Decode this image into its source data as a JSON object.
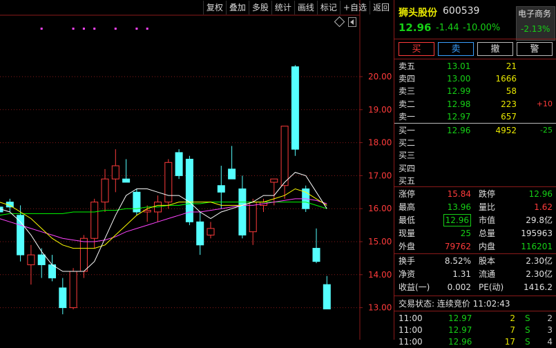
{
  "toolbar": {
    "items": [
      "复权",
      "叠加",
      "多股",
      "统计",
      "画线",
      "标记",
      "+自选",
      "返回"
    ]
  },
  "header": {
    "name": "狮头股份",
    "code": "600539",
    "price": "12.96",
    "change": "-1.44",
    "pct": "-10.00%",
    "sector": "电子商务",
    "sector_pct": "-2.13%"
  },
  "buttons": {
    "buy": "买",
    "sell": "卖",
    "cancel": "撤",
    "alert": "警"
  },
  "orderbook": {
    "asks": [
      {
        "label": "卖五",
        "price": "13.01",
        "vol": "21",
        "delta": ""
      },
      {
        "label": "卖四",
        "price": "13.00",
        "vol": "1666",
        "delta": ""
      },
      {
        "label": "卖三",
        "price": "12.99",
        "vol": "58",
        "delta": ""
      },
      {
        "label": "卖二",
        "price": "12.98",
        "vol": "223",
        "delta": "+10"
      },
      {
        "label": "卖一",
        "price": "12.97",
        "vol": "657",
        "delta": ""
      }
    ],
    "bids": [
      {
        "label": "买一",
        "price": "12.96",
        "vol": "4952",
        "delta": "-25"
      },
      {
        "label": "买二",
        "price": "",
        "vol": "",
        "delta": ""
      },
      {
        "label": "买三",
        "price": "",
        "vol": "",
        "delta": ""
      },
      {
        "label": "买四",
        "price": "",
        "vol": "",
        "delta": ""
      },
      {
        "label": "买五",
        "price": "",
        "vol": "",
        "delta": ""
      }
    ]
  },
  "stats1": [
    {
      "l1": "涨停",
      "v1": "15.84",
      "l2": "跌停",
      "v2": "12.96"
    },
    {
      "l1": "最高",
      "v1": "13.96",
      "l2": "量比",
      "v2": "1.62"
    },
    {
      "l1": "最低",
      "v1": "12.96",
      "l2": "市值",
      "v2": "29.8亿"
    },
    {
      "l1": "现量",
      "v1": "25",
      "l2": "总量",
      "v2": "195963"
    },
    {
      "l1": "外盘",
      "v1": "79762",
      "l2": "内盘",
      "v2": "116201"
    }
  ],
  "stats2": [
    {
      "l1": "换手",
      "v1": "8.52%",
      "l2": "股本",
      "v2": "2.30亿"
    },
    {
      "l1": "净资",
      "v1": "1.31",
      "l2": "流通",
      "v2": "2.30亿"
    },
    {
      "l1": "收益(一)",
      "v1": "0.002",
      "l2": "PE(动)",
      "v2": "1416.2"
    }
  ],
  "status": {
    "text": "交易状态: 连续竞价 11:02:43"
  },
  "ticks": [
    {
      "time": "11:00",
      "price": "12.97",
      "vol": "2",
      "side": "S",
      "n": "2"
    },
    {
      "time": "11:00",
      "price": "12.97",
      "vol": "7",
      "side": "S",
      "n": "3"
    },
    {
      "time": "11:00",
      "price": "12.96",
      "vol": "17",
      "side": "S",
      "n": "4"
    }
  ],
  "chart_data": {
    "type": "candlestick",
    "y_ticks": [
      "20.00",
      "19.00",
      "18.00",
      "17.00",
      "16.00",
      "15.00",
      "14.00",
      "13.00"
    ],
    "ylim": [
      12.9,
      21.0
    ],
    "grid": "dotted-horizontal",
    "colors": {
      "up": "#ff3b3b",
      "down": "#55ffff",
      "ma5": "#ffffff",
      "ma10": "#ffff00",
      "ma20": "#ff44ff",
      "ma60": "#00ff00",
      "grid": "#8b1a1a"
    },
    "candles": [
      {
        "o": 16.05,
        "h": 16.2,
        "l": 15.6,
        "c": 15.9
      },
      {
        "o": 16.2,
        "h": 16.3,
        "l": 15.9,
        "c": 16.05
      },
      {
        "o": 15.8,
        "h": 16.1,
        "l": 14.4,
        "c": 14.6
      },
      {
        "o": 14.3,
        "h": 14.9,
        "l": 13.7,
        "c": 14.6
      },
      {
        "o": 14.6,
        "h": 14.8,
        "l": 13.9,
        "c": 14.3
      },
      {
        "o": 14.3,
        "h": 14.6,
        "l": 13.8,
        "c": 13.9
      },
      {
        "o": 13.6,
        "h": 13.9,
        "l": 12.8,
        "c": 13.0
      },
      {
        "o": 13.0,
        "h": 14.2,
        "l": 12.95,
        "c": 14.1
      },
      {
        "o": 14.1,
        "h": 15.2,
        "l": 13.9,
        "c": 15.1
      },
      {
        "o": 15.1,
        "h": 16.3,
        "l": 14.8,
        "c": 16.2
      },
      {
        "o": 16.2,
        "h": 17.2,
        "l": 15.9,
        "c": 16.9
      },
      {
        "o": 16.9,
        "h": 17.8,
        "l": 16.5,
        "c": 17.3
      },
      {
        "o": 16.9,
        "h": 17.5,
        "l": 16.8,
        "c": 16.8
      },
      {
        "o": 16.5,
        "h": 16.6,
        "l": 15.8,
        "c": 15.9
      },
      {
        "o": 15.9,
        "h": 16.1,
        "l": 15.6,
        "c": 15.95
      },
      {
        "o": 15.9,
        "h": 16.4,
        "l": 15.6,
        "c": 16.2
      },
      {
        "o": 16.2,
        "h": 17.5,
        "l": 16.0,
        "c": 17.4
      },
      {
        "o": 17.7,
        "h": 17.8,
        "l": 16.9,
        "c": 17.0
      },
      {
        "o": 17.5,
        "h": 17.6,
        "l": 15.5,
        "c": 15.6
      },
      {
        "o": 15.6,
        "h": 15.9,
        "l": 14.6,
        "c": 14.9
      },
      {
        "o": 15.2,
        "h": 15.6,
        "l": 15.1,
        "c": 15.4
      },
      {
        "o": 16.7,
        "h": 17.3,
        "l": 16.0,
        "c": 16.5
      },
      {
        "o": 17.2,
        "h": 17.9,
        "l": 16.9,
        "c": 16.9
      },
      {
        "o": 16.6,
        "h": 17.0,
        "l": 15.1,
        "c": 15.2
      },
      {
        "o": 15.3,
        "h": 16.3,
        "l": 14.9,
        "c": 16.2
      },
      {
        "o": 16.1,
        "h": 16.3,
        "l": 15.9,
        "c": 16.2
      },
      {
        "o": 16.8,
        "h": 16.9,
        "l": 16.1,
        "c": 16.9
      },
      {
        "o": 16.7,
        "h": 17.0,
        "l": 16.3,
        "c": 18.5
      },
      {
        "o": 20.3,
        "h": 20.35,
        "l": 17.6,
        "c": 17.8
      },
      {
        "o": 16.6,
        "h": 16.7,
        "l": 15.9,
        "c": 16.0
      },
      {
        "o": 14.8,
        "h": 15.4,
        "l": 14.35,
        "c": 14.4
      },
      {
        "o": 13.7,
        "h": 13.96,
        "l": 12.96,
        "c": 12.96
      }
    ],
    "ma5": [
      16.0,
      15.9,
      15.6,
      15.2,
      14.7,
      14.3,
      14.1,
      14.1,
      14.1,
      14.4,
      15.1,
      15.8,
      16.4,
      16.6,
      16.6,
      16.5,
      16.4,
      16.4,
      16.2,
      15.9,
      15.7,
      15.9,
      16.0,
      16.1,
      16.2,
      16.4,
      16.4,
      16.8,
      17.1,
      17.0,
      16.5,
      16.0
    ],
    "ma10": [
      16.2,
      16.1,
      15.9,
      15.7,
      15.4,
      15.1,
      14.9,
      14.8,
      14.8,
      14.8,
      14.9,
      15.2,
      15.5,
      15.8,
      16.0,
      16.1,
      16.1,
      16.2,
      16.2,
      16.2,
      16.2,
      16.1,
      16.1,
      16.1,
      16.2,
      16.2,
      16.3,
      16.4,
      16.6,
      16.5,
      16.3,
      16.1
    ],
    "ma20": [
      15.7,
      15.6,
      15.5,
      15.4,
      15.3,
      15.2,
      15.1,
      15.05,
      15.0,
      15.0,
      15.05,
      15.15,
      15.3,
      15.4,
      15.5,
      15.6,
      15.7,
      15.8,
      15.9,
      15.9,
      15.95,
      16.0,
      16.05,
      16.1,
      16.1,
      16.15,
      16.2,
      16.25,
      16.3,
      16.3,
      16.25,
      16.15
    ],
    "ma60": [
      15.8,
      15.85,
      15.85,
      15.85,
      15.85,
      15.85,
      15.85,
      15.9,
      15.9,
      15.9,
      15.95,
      15.95,
      16.0,
      16.0,
      16.05,
      16.05,
      16.1,
      16.1,
      16.15,
      16.15,
      16.2,
      16.2,
      16.2,
      16.2,
      16.2,
      16.2,
      16.2,
      16.2,
      16.2,
      16.2,
      16.1,
      16.0
    ],
    "markers": [
      4,
      7,
      8,
      9,
      11,
      13,
      14
    ]
  }
}
